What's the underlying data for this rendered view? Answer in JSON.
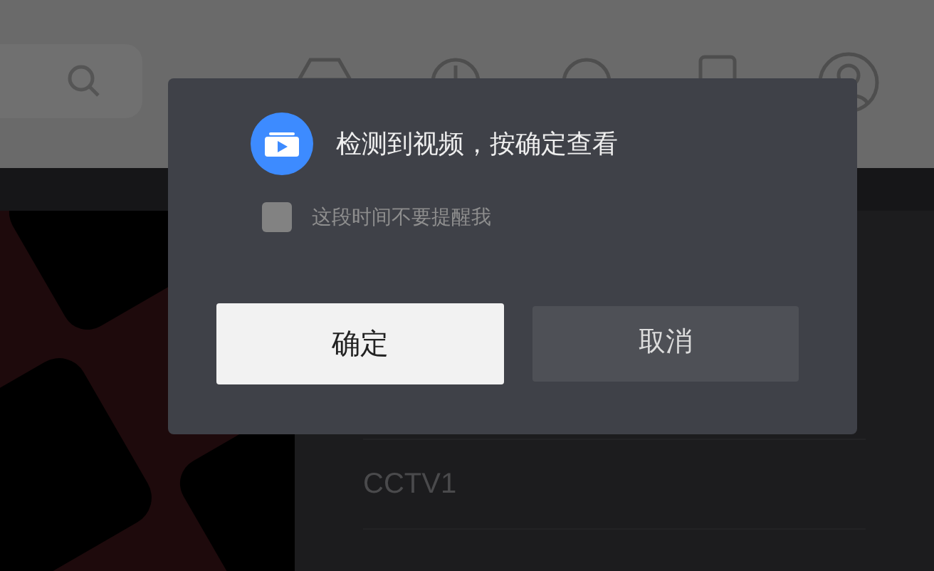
{
  "dialog": {
    "message": "检测到视频，按确定查看",
    "checkbox": {
      "label": "这段时间不要提醒我",
      "checked": false
    },
    "buttons": [
      {
        "label": "确定",
        "selected": true
      },
      {
        "label": "取消",
        "selected": false
      }
    ]
  },
  "channel_list": [
    {
      "name": "CCTV1"
    }
  ]
}
